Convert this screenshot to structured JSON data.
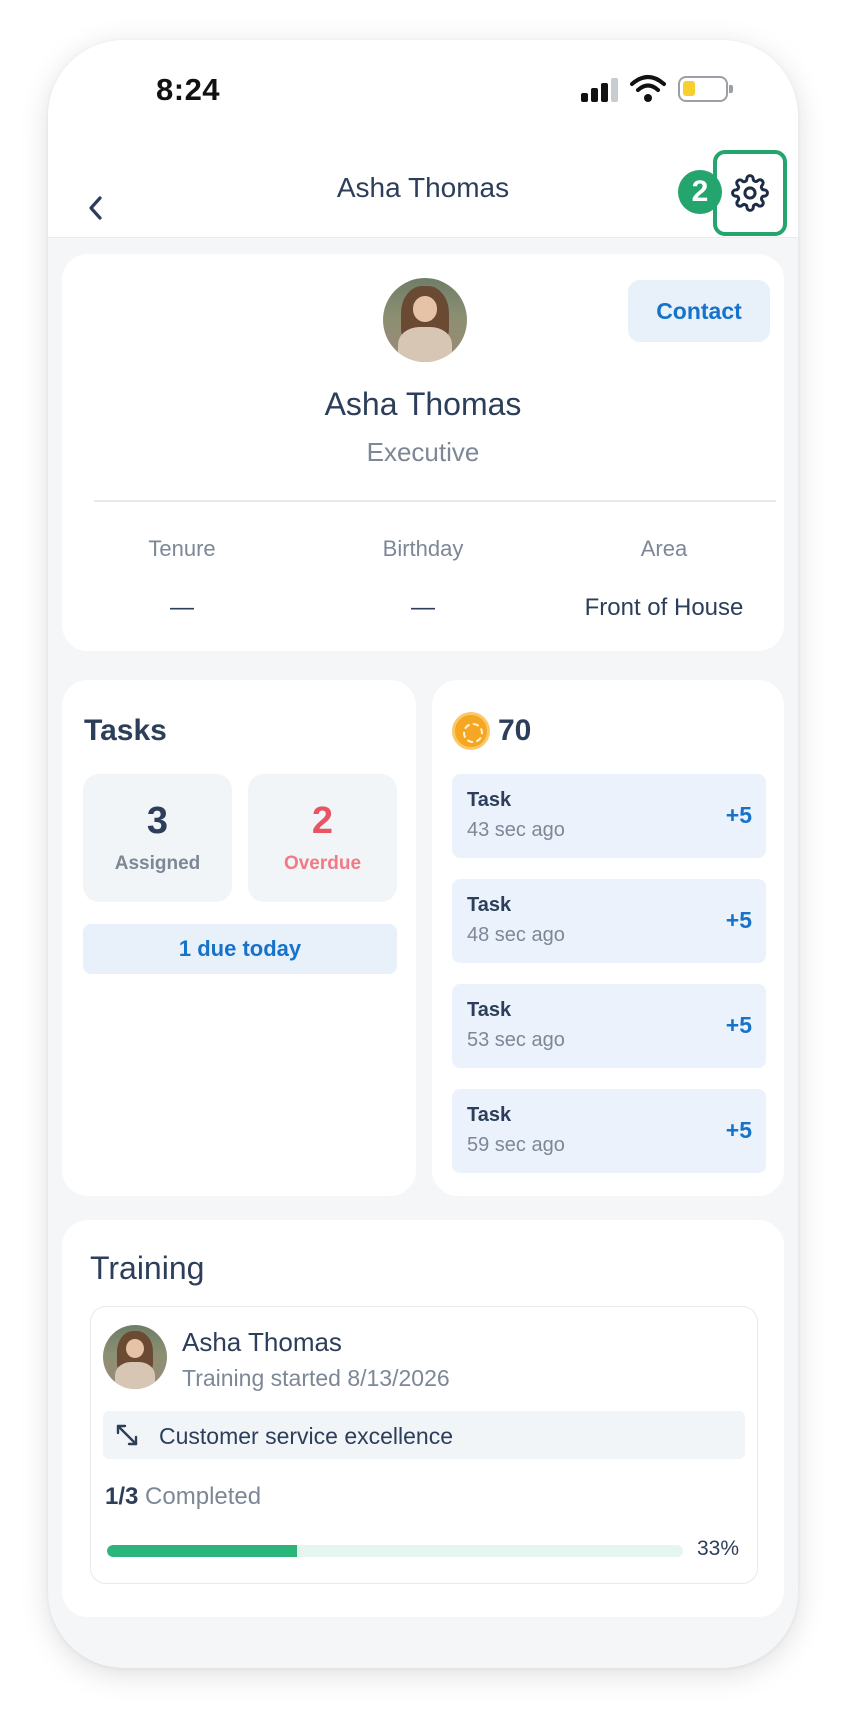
{
  "status_bar": {
    "time": "8:24"
  },
  "header": {
    "title": "Asha Thomas",
    "step_badge": "2"
  },
  "profile": {
    "name": "Asha Thomas",
    "role": "Executive",
    "contact_label": "Contact",
    "info": [
      {
        "label": "Tenure",
        "value": "—"
      },
      {
        "label": "Birthday",
        "value": "—"
      },
      {
        "label": "Area",
        "value": "Front of House"
      }
    ]
  },
  "tasks": {
    "title": "Tasks",
    "assigned": {
      "count": "3",
      "label": "Assigned"
    },
    "overdue": {
      "count": "2",
      "label": "Overdue"
    },
    "due_today": "1 due today"
  },
  "points": {
    "total": "70",
    "items": [
      {
        "label": "Task",
        "time": "43 sec ago",
        "points": "+5"
      },
      {
        "label": "Task",
        "time": "48 sec ago",
        "points": "+5"
      },
      {
        "label": "Task",
        "time": "53 sec ago",
        "points": "+5"
      },
      {
        "label": "Task",
        "time": "59 sec ago",
        "points": "+5"
      }
    ]
  },
  "training": {
    "title": "Training",
    "name": "Asha Thomas",
    "started": "Training started 8/13/2026",
    "course": "Customer service excellence",
    "completed_fraction": "1/3",
    "completed_word": "Completed",
    "progress_percent": 33,
    "progress_label": "33%"
  },
  "colors": {
    "accent_blue": "#1673c9",
    "overdue_red": "#e85462",
    "highlight_green": "#24a56e",
    "progress_green": "#2bb57a"
  }
}
